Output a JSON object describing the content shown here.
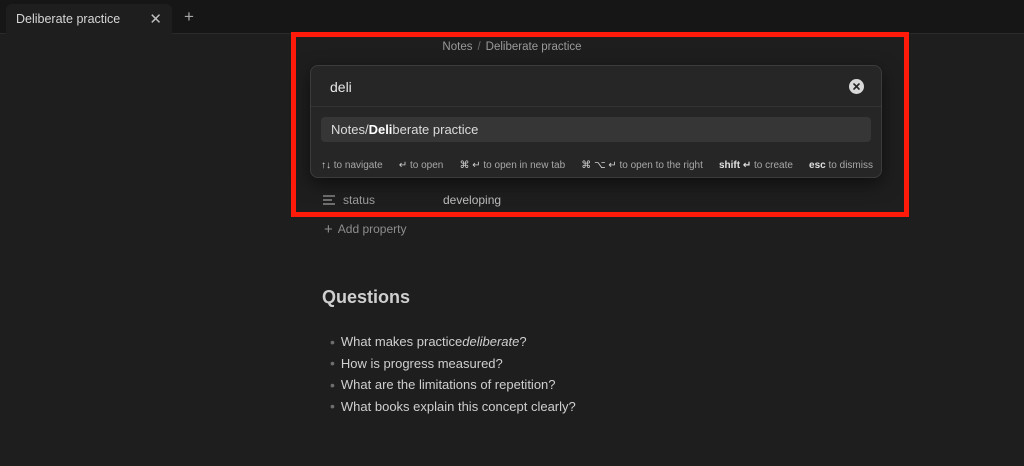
{
  "tabbar": {
    "active_tab": "Deliberate practice",
    "close_glyph": "✕",
    "new_tab_glyph": "+"
  },
  "breadcrumb": {
    "folder": "Notes",
    "separator": "/",
    "note": "Deliberate practice"
  },
  "properties": {
    "status_icon": "text-lines-icon",
    "status_name": "status",
    "status_value": "developing",
    "add_label": "Add property"
  },
  "content": {
    "heading": "Questions",
    "questions": [
      {
        "prefix": "What makes practice ",
        "emphasis": "deliberate",
        "suffix": "?"
      },
      {
        "prefix": "How is progress measured?",
        "emphasis": "",
        "suffix": ""
      },
      {
        "prefix": "What are the limitations of repetition?",
        "emphasis": "",
        "suffix": ""
      },
      {
        "prefix": "What books explain this concept clearly?",
        "emphasis": "",
        "suffix": ""
      }
    ]
  },
  "switcher": {
    "query": "deli",
    "result": {
      "prefix": "Notes/",
      "match": "Deli",
      "suffix": "berate practice"
    },
    "hints": [
      {
        "key": "↑↓",
        "label": "to navigate",
        "bold": false
      },
      {
        "key": "↵",
        "label": "to open",
        "bold": false
      },
      {
        "key": "⌘ ↵",
        "label": "to open in new tab",
        "bold": false
      },
      {
        "key": "⌘ ⌥ ↵",
        "label": "to open to the right",
        "bold": false
      },
      {
        "key": "shift ↵",
        "label": "to create",
        "bold": true
      },
      {
        "key": "esc",
        "label": "to dismiss",
        "bold": true
      }
    ]
  },
  "colors": {
    "background": "#1e1e1e",
    "annotation": "#ff1a0a",
    "result_highlight": "#363636"
  }
}
